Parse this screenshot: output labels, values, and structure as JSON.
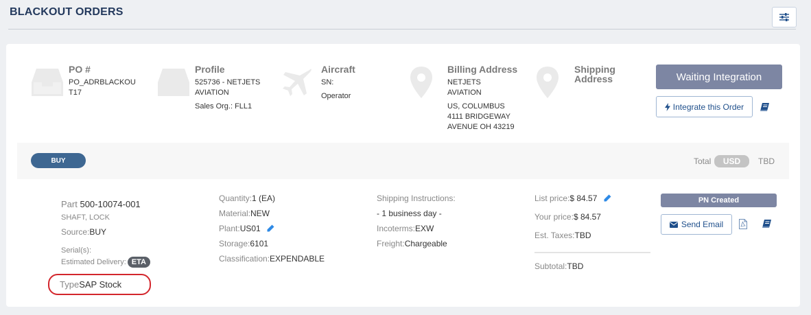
{
  "page": {
    "title": "BLACKOUT ORDERS",
    "filter_icon": "sliders-icon"
  },
  "header": {
    "po": {
      "title": "PO #",
      "lines": [
        "PO_ADRBLACKOU",
        "T17"
      ],
      "icon": "inbox-tray-icon"
    },
    "profile": {
      "title": "Profile",
      "lines": [
        "525736 - NETJETS",
        "AVIATION"
      ],
      "sales_org": "Sales Org.: FLL1",
      "icon": "inbox-tray-icon"
    },
    "aircraft": {
      "title": "Aircraft",
      "sn": "SN:",
      "operator": "Operator",
      "icon": "airplane-icon"
    },
    "billing": {
      "title": "Billing Address",
      "lines": [
        "NETJETS",
        "AVIATION",
        "US, COLUMBUS",
        "4111 BRIDGEWAY",
        "AVENUE OH 43219"
      ],
      "icon": "map-pin-icon"
    },
    "shipping": {
      "title_line1": "Shipping",
      "title_line2": "Address",
      "icon": "map-pin-icon"
    },
    "actions": {
      "waiting_label": "Waiting Integration",
      "integrate_label": "Integrate this Order",
      "integrate_icon": "bolt-icon",
      "book_icon": "book-icon"
    }
  },
  "band": {
    "buy_label": "BUY",
    "total_label": "Total",
    "currency": "USD",
    "total_value": "TBD"
  },
  "line_item": {
    "part_label": "Part",
    "part_number": "500-10074-001",
    "description": "SHAFT, LOCK",
    "source_label": "Source:",
    "source_value": "BUY",
    "serials_label": "Serial(s):",
    "est_delivery_label": "Estimated Delivery:",
    "eta_badge": "ETA",
    "type_label": "Type",
    "type_value": "SAP Stock",
    "quantity_label": "Quantity:",
    "quantity_value": "1 (EA)",
    "material_label": "Material:",
    "material_value": "NEW",
    "plant_label": "Plant:",
    "plant_value": "US01",
    "storage_label": "Storage:",
    "storage_value": "6101",
    "classification_label": "Classification:",
    "classification_value": "EXPENDABLE",
    "shipping_instructions_label": "Shipping Instructions:",
    "shipping_instructions_value": "- 1 business day -",
    "incoterms_label": "Incoterms:",
    "incoterms_value": "EXW",
    "freight_label": "Freight:",
    "freight_value": "Chargeable",
    "list_price_label": "List price:",
    "list_price_value": "$ 84.57",
    "your_price_label": "Your price:",
    "your_price_value": "$ 84.57",
    "est_taxes_label": "Est. Taxes:",
    "est_taxes_value": "TBD",
    "subtotal_label": "Subtotal:",
    "subtotal_value": "TBD",
    "pn_status": "PN Created",
    "send_email_label": "Send Email",
    "email_icon": "envelope-icon",
    "pdf_icon": "pdf-file-icon",
    "book_icon": "book-icon"
  },
  "colors": {
    "accent_blue": "#3e6792",
    "slate": "#7d86a3",
    "link_blue": "#1f4f8b",
    "highlight_red": "#d3262c"
  }
}
